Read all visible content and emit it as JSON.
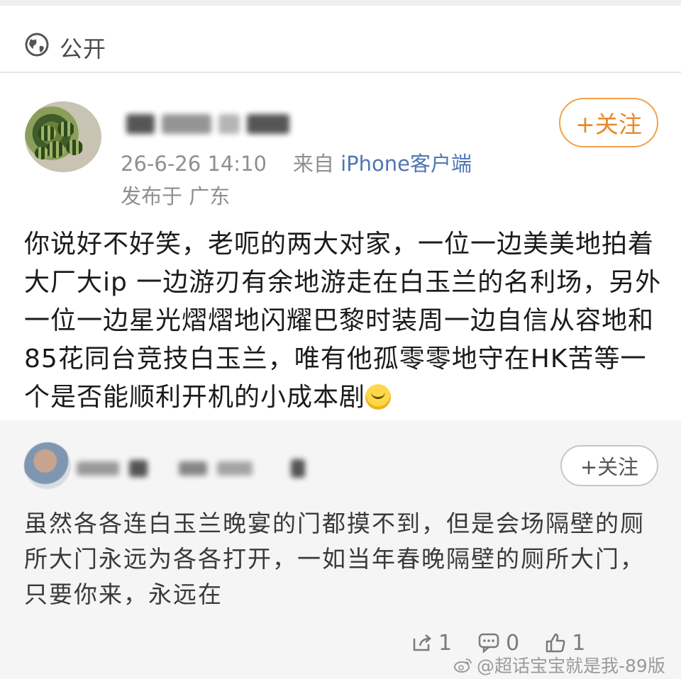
{
  "visibility": {
    "label": "公开",
    "icon": "globe-icon"
  },
  "post": {
    "meta_time": "26-6-26 14:10",
    "meta_from_prefix": "来自",
    "meta_client": "iPhone客户端",
    "meta_location": "发布于 广东",
    "follow_label": "+关注",
    "text": "你说好不好笑，老呃的两大对家，一位一边美美地拍着大厂大ip 一边游刃有余地游走在白玉兰的名利场，另外一位一边星光熠熠地闪耀巴黎时装周一边自信从容地和85花同台竞技白玉兰，唯有他孤零零地守在HK苦等一个是否能顺利开机的小成本剧"
  },
  "repost": {
    "follow_label": "+关注",
    "text": "虽然各各连白玉兰晚宴的门都摸不到，但是会场隔壁的厕所大门永远为各各打开，一如当年春晚隔壁的厕所大门，只要你来，永远在",
    "actions": {
      "share_count": "1",
      "comment_count": "0",
      "like_count": "1"
    }
  },
  "watermark": "@超话宝宝就是我-89版",
  "colors": {
    "accent": "#e8892c",
    "client_link": "#4f76b5"
  }
}
